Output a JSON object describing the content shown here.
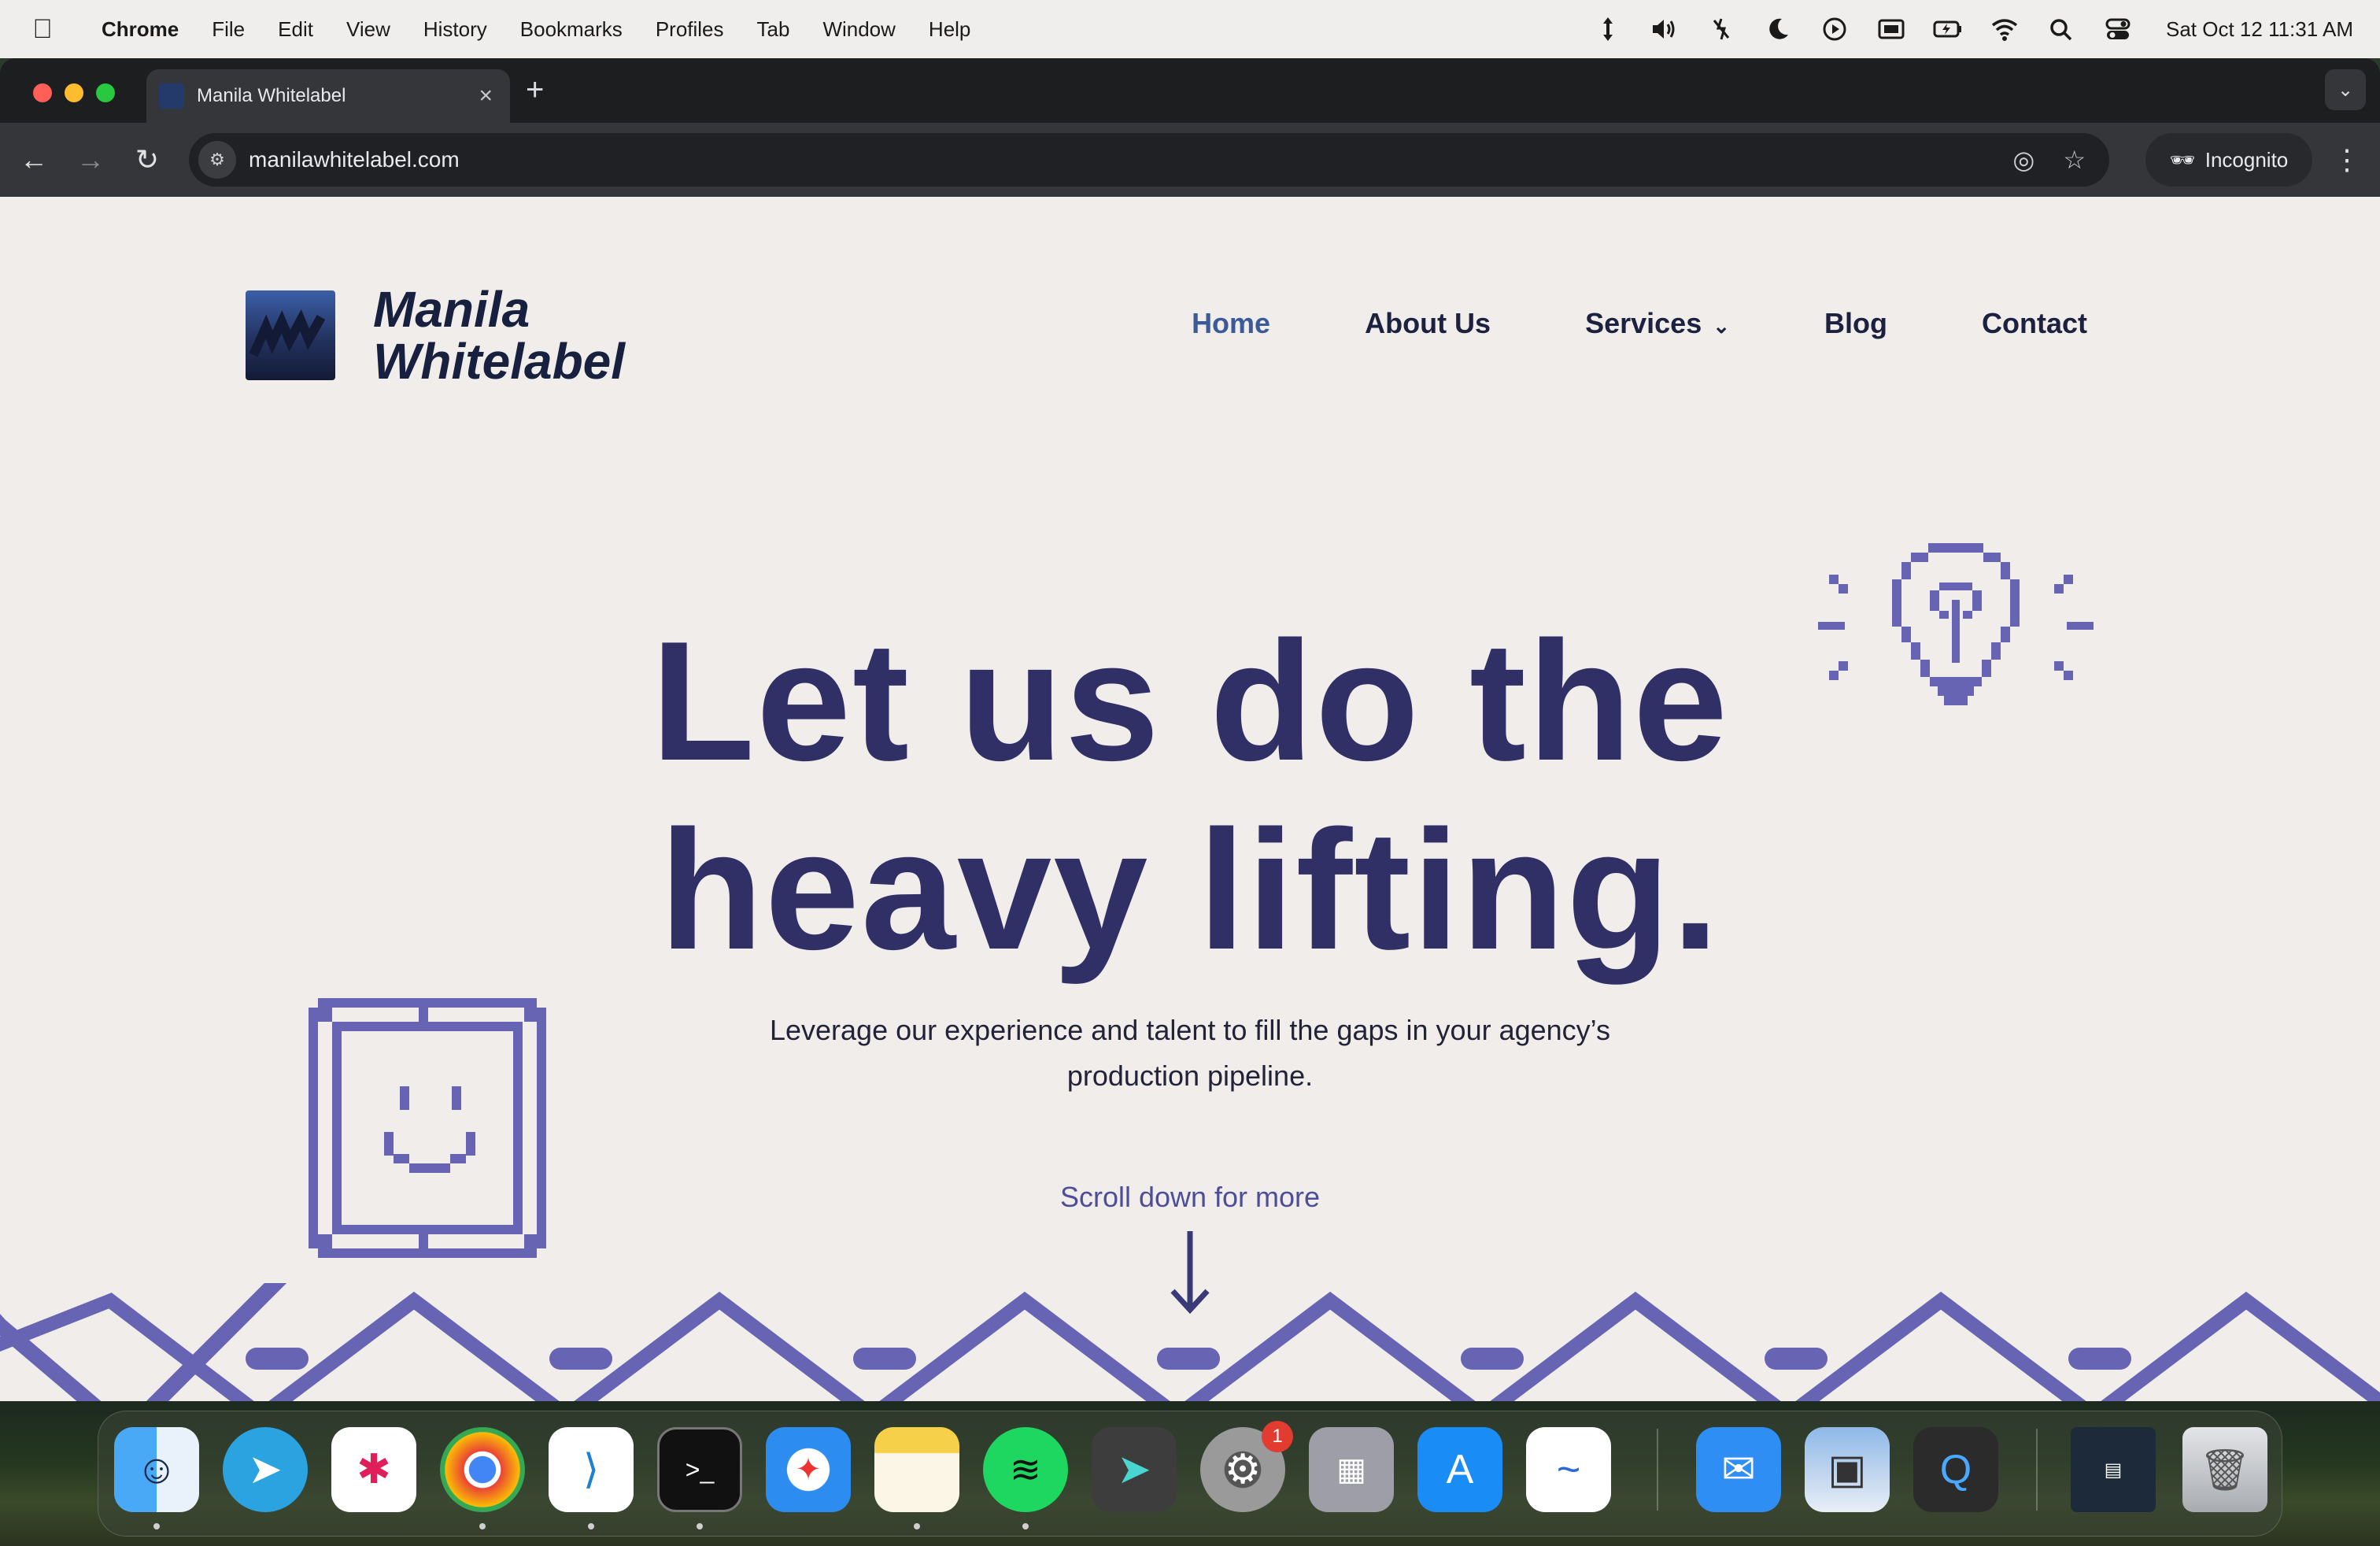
{
  "menubar": {
    "app_name": "Chrome",
    "items": [
      "File",
      "Edit",
      "View",
      "History",
      "Bookmarks",
      "Profiles",
      "Tab",
      "Window",
      "Help"
    ],
    "clock": "Sat Oct 12  11:31 AM"
  },
  "browser": {
    "tab_title": "Manila Whitelabel",
    "url": "manilawhitelabel.com",
    "incognito_label": "Incognito"
  },
  "site": {
    "logo_line1": "Manila",
    "logo_line2": "Whitelabel",
    "nav": {
      "home": "Home",
      "about": "About Us",
      "services": "Services",
      "blog": "Blog",
      "contact": "Contact"
    },
    "hero_line1": "Let us do the",
    "hero_line2": "heavy lifting.",
    "subtitle_line1": "Leverage our experience and talent to fill the gaps in your agency’s",
    "subtitle_line2": "production pipeline.",
    "scroll_label": "Scroll down for more",
    "colors": {
      "background": "#f0edea",
      "heading": "#302f66",
      "accent": "#6864b4",
      "nav_active": "#3a5a9a"
    }
  },
  "dock": {
    "apps": [
      "Finder",
      "Telegram",
      "Slack",
      "Google Chrome",
      "Visual Studio Code",
      "Terminal",
      "Safari",
      "Notes",
      "Spotify",
      "Prompt",
      "System Settings",
      "Launchpad",
      "App Store",
      "Freeform",
      "Mail",
      "Preview",
      "QuickTime Player",
      "Downloads",
      "Trash"
    ],
    "settings_badge": "1"
  }
}
